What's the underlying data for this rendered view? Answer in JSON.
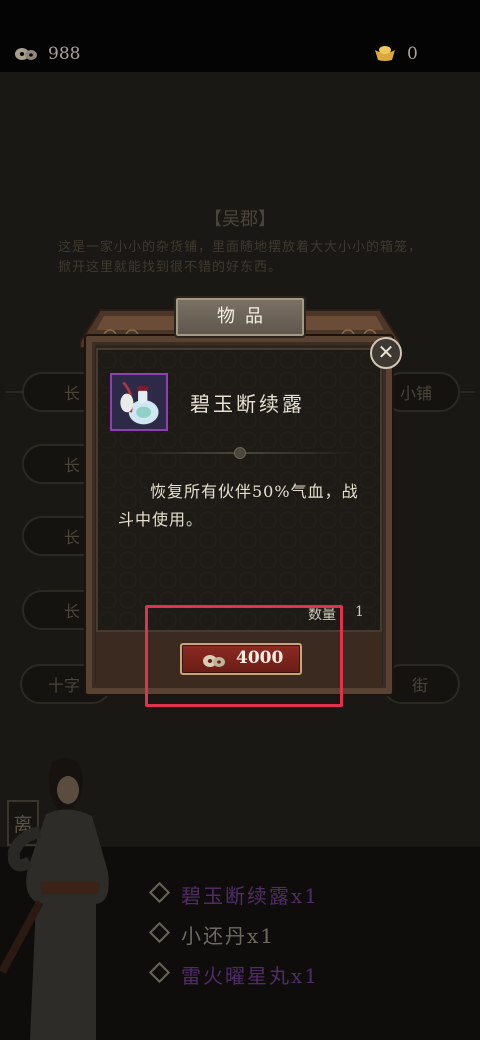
{
  "top_bar": {
    "coins": "988",
    "ingots": "0"
  },
  "background": {
    "location_title": "【吴郡】",
    "location_desc": "这是一家小小的杂货铺，里面随地摆放着大大小小的箱笼，掀开这里就能找到很不错的好东西。",
    "buttons": [
      "长",
      "长",
      "长",
      "长",
      "十字",
      "小铺",
      "街"
    ]
  },
  "modal": {
    "tab_title": "物品",
    "item_name": "碧玉断续露",
    "item_desc": "恢复所有伙伴50%气血，战斗中使用。",
    "quantity_label": "数量",
    "quantity_value": "1",
    "price": "4000",
    "close_symbol": "✕"
  },
  "bottom": {
    "leave_label": "离",
    "rewards": [
      {
        "label": "碧玉断续露x1",
        "color": "#6b3a8a"
      },
      {
        "label": "小还丹x1",
        "color": "#8f8a80"
      },
      {
        "label": "雷火曜星丸x1",
        "color": "#6b3a8a"
      }
    ]
  },
  "colors": {
    "highlight": "#e0334f",
    "rare_item": "#8e3fb3",
    "price_button": "#8b2a22"
  },
  "icons": [
    "coin-icon",
    "ingot-icon",
    "close-icon",
    "item-bottle-icon"
  ]
}
